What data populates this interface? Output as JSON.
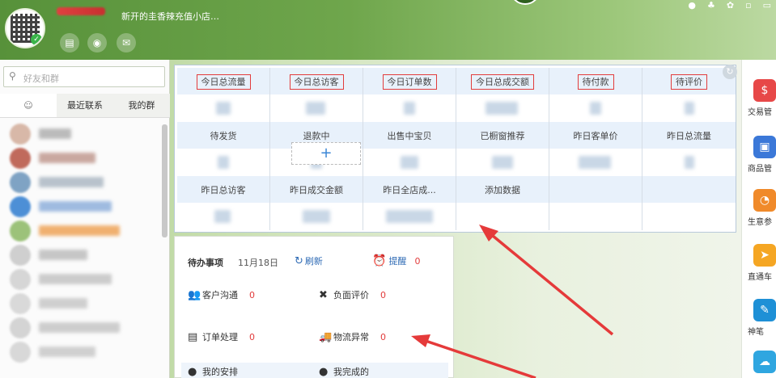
{
  "header": {
    "signature": "新开的圭香辣充值小店…",
    "icons": [
      "contact-card-icon",
      "app-icon",
      "mail-icon"
    ],
    "window_controls": [
      "settings-icon",
      "shirt-icon",
      "gear-icon",
      "minimize-icon",
      "maximize-icon"
    ]
  },
  "sidebar": {
    "search_placeholder": "好友和群",
    "tabs": [
      "",
      "最近联系",
      "我的群"
    ]
  },
  "stats": {
    "row1_labels": [
      "今日总流量",
      "今日总访客",
      "今日订单数",
      "今日总成交额",
      "待付款",
      "待评价"
    ],
    "row2_labels": [
      "待发货",
      "退款中",
      "出售中宝贝",
      "已橱窗推荐",
      "昨日客单价",
      "昨日总流量"
    ],
    "row3_labels": [
      "昨日总访客",
      "昨日成交金额",
      "昨日全店成...",
      "添加数据",
      "",
      ""
    ],
    "add_symbol": "+"
  },
  "todo": {
    "title": "待办事项",
    "date": "11月18日",
    "refresh_label": "刷新",
    "remind_label": "提醒",
    "remind_count": "0",
    "items": [
      {
        "label": "客户沟通",
        "count": "0"
      },
      {
        "label": "负面评价",
        "count": "0"
      },
      {
        "label": "订单处理",
        "count": "0"
      },
      {
        "label": "物流异常",
        "count": "0"
      },
      {
        "label": "我的安排",
        "count": ""
      },
      {
        "label": "我完成的",
        "count": ""
      }
    ]
  },
  "right_toolbar": {
    "items": [
      {
        "label": "交易管",
        "color": "#e74848"
      },
      {
        "label": "商品管",
        "color": "#3b78d8"
      },
      {
        "label": "生意参",
        "color": "#f08a2a"
      },
      {
        "label": "直通车",
        "color": "#f5a623"
      },
      {
        "label": "神笔",
        "color": "#1e90d6"
      },
      {
        "label": "",
        "color": "#2fa6e0"
      }
    ]
  },
  "colors": {
    "highlight_red": "#e23c3c",
    "link_blue": "#2f6bb5",
    "grid_header_bg": "#e8f1fb"
  }
}
